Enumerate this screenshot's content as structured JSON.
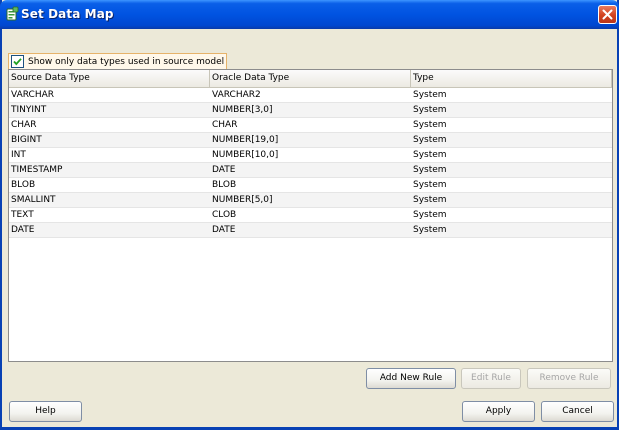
{
  "window": {
    "title": "Set Data Map",
    "close_icon": "close-icon",
    "app_icon": "app-icon"
  },
  "filter": {
    "checkbox_label": "Show only data types used in source model",
    "checked": true
  },
  "table": {
    "headers": [
      "Source Data Type",
      "Oracle Data Type",
      "Type"
    ],
    "rows": [
      [
        "VARCHAR",
        "VARCHAR2",
        "System"
      ],
      [
        "TINYINT",
        "NUMBER[3,0]",
        "System"
      ],
      [
        "CHAR",
        "CHAR",
        "System"
      ],
      [
        "BIGINT",
        "NUMBER[19,0]",
        "System"
      ],
      [
        "INT",
        "NUMBER[10,0]",
        "System"
      ],
      [
        "TIMESTAMP",
        "DATE",
        "System"
      ],
      [
        "BLOB",
        "BLOB",
        "System"
      ],
      [
        "SMALLINT",
        "NUMBER[5,0]",
        "System"
      ],
      [
        "TEXT",
        "CLOB",
        "System"
      ],
      [
        "DATE",
        "DATE",
        "System"
      ]
    ]
  },
  "rule_buttons": {
    "add": "Add New Rule",
    "edit": "Edit Rule",
    "remove": "Remove Rule"
  },
  "footer": {
    "help": "Help",
    "apply": "Apply",
    "cancel": "Cancel"
  },
  "colors": {
    "titlebar": "#0053e1",
    "dialog_bg": "#ece9d8",
    "close_button": "#d2421f"
  }
}
